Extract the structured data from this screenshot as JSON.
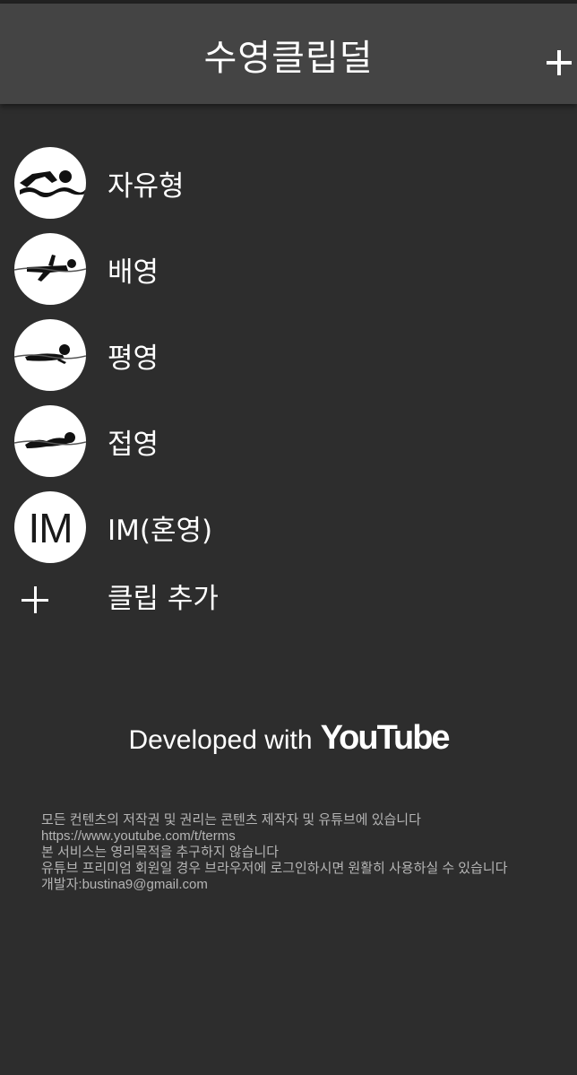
{
  "header": {
    "title": "수영클립덜"
  },
  "strokes": [
    {
      "label": "자유형",
      "icon": "freestyle-swimmer-icon"
    },
    {
      "label": "배영",
      "icon": "backstroke-swimmer-icon"
    },
    {
      "label": "평영",
      "icon": "breaststroke-swimmer-icon"
    },
    {
      "label": "접영",
      "icon": "butterfly-swimmer-icon"
    },
    {
      "label": "IM(혼영)",
      "icon_text": "IM"
    }
  ],
  "add_clip": {
    "label": "클립 추가"
  },
  "credit": {
    "prefix": "Developed with",
    "logo": "YouTube"
  },
  "notice": {
    "lines": [
      "모든 컨텐츠의 저작권 및 권리는 콘텐츠 제작자 및 유튜브에 있습니다",
      "https://www.youtube.com/t/terms",
      "본 서비스는 영리목적을 추구하지 않습니다",
      "유튜브 프리미엄 회원일 경우 브라우저에 로그인하시면 원활히 사용하실 수 있습니다",
      "개발자:bustina9@gmail.com"
    ]
  },
  "colors": {
    "background": "#2d2d2d",
    "header": "#444444",
    "text": "#ffffff",
    "notice_text": "#b5b5b5"
  }
}
